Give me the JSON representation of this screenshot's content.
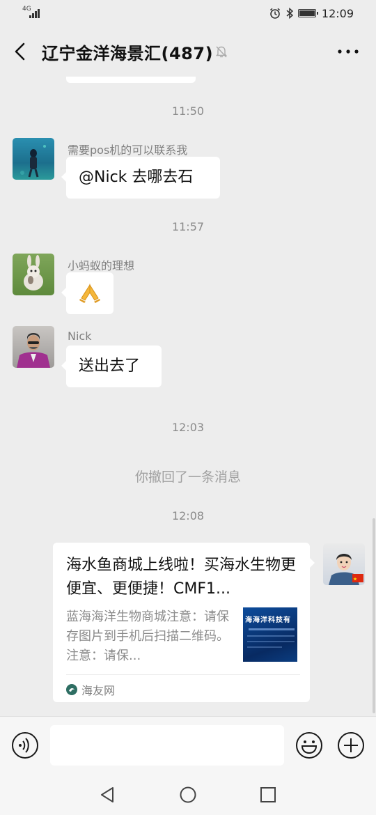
{
  "status_bar": {
    "network_label": "4G",
    "time": "12:09",
    "battery_level": 0.95,
    "icons": [
      "signal-icon",
      "alarm-icon",
      "bluetooth-icon",
      "battery-icon"
    ]
  },
  "header": {
    "title": "辽宁金洋海景汇(487)",
    "icons": [
      "back-arrow-icon",
      "muted-bell-icon",
      "more-options-icon"
    ]
  },
  "messages": [
    {
      "type": "timestamp",
      "text": "11:50"
    },
    {
      "type": "message",
      "sender": "需要pos机的可以联系我",
      "text": "@Nick  去哪去石",
      "avatar": "diver-photo"
    },
    {
      "type": "timestamp",
      "text": "11:57"
    },
    {
      "type": "message",
      "sender": "小蚂蚁的理想",
      "content": "praying-hands-emoji",
      "avatar": "rabbit-photo"
    },
    {
      "type": "message",
      "sender": "Nick",
      "text": "送出去了",
      "avatar": "man-purple-suit-photo"
    },
    {
      "type": "timestamp",
      "text": "12:03"
    },
    {
      "type": "system",
      "text": "你撤回了一条消息"
    },
    {
      "type": "timestamp",
      "text": "12:08"
    },
    {
      "type": "link_card",
      "from": "self",
      "title": "海水鱼商城上线啦！买海水生物更便宜、更便捷！CMF1...",
      "description": "蓝海海洋生物商城注意：请保存图片到手机后扫描二维码。注意：请保...",
      "thumbnail_text": "海海洋科技有",
      "source": "海友网",
      "avatar": "child-photo-with-china-flag"
    }
  ],
  "input_bar": {
    "icons": [
      "voice-input-icon",
      "emoji-icon",
      "add-more-icon"
    ]
  },
  "nav_bar": {
    "icons": [
      "nav-back-icon",
      "nav-home-icon",
      "nav-recents-icon"
    ]
  }
}
